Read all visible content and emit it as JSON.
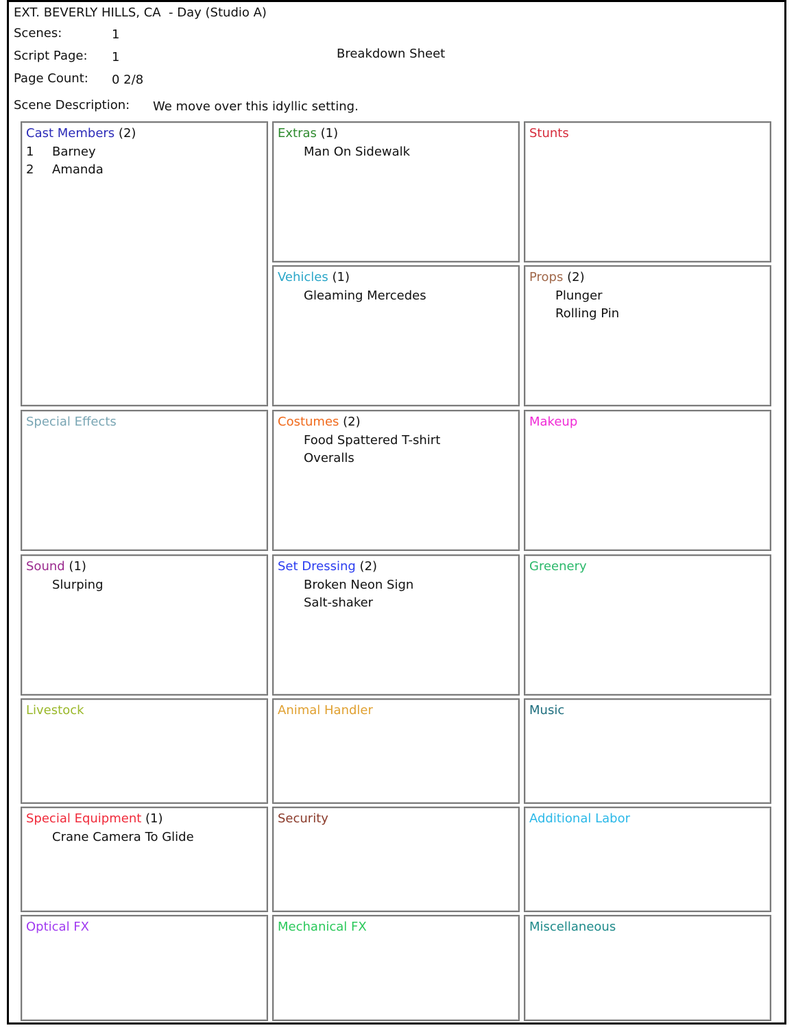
{
  "header": {
    "location": "EXT. BEVERLY HILLS, CA  - Day (Studio A)",
    "scenes_label": "Scenes:",
    "scenes_value": "1",
    "script_page_label": "Script Page:",
    "script_page_value": "1",
    "page_count_label": "Page Count:",
    "page_count_value": "0  2/8",
    "scene_description_label": "Scene Description:",
    "scene_description_value": "We move over this idyllic setting.",
    "sheet_title": "Breakdown Sheet"
  },
  "categories": {
    "cast": {
      "name": "Cast Members",
      "count": "(2)",
      "color": "#2b2bb8",
      "items": [
        {
          "num": "1",
          "label": "Barney"
        },
        {
          "num": "2",
          "label": "Amanda"
        }
      ]
    },
    "extras": {
      "name": "Extras",
      "count": "(1)",
      "color": "#2e8b2e",
      "items": [
        "Man On Sidewalk"
      ]
    },
    "stunts": {
      "name": "Stunts",
      "count": "",
      "color": "#d62b3b",
      "items": []
    },
    "vehicles": {
      "name": "Vehicles",
      "count": "(1)",
      "color": "#2aa6c8",
      "items": [
        "Gleaming Mercedes"
      ]
    },
    "props": {
      "name": "Props",
      "count": "(2)",
      "color": "#a0684a",
      "items": [
        "Plunger",
        "Rolling Pin"
      ]
    },
    "special_effects": {
      "name": "Special Effects",
      "count": "",
      "color": "#7aa6b4",
      "items": []
    },
    "costumes": {
      "name": "Costumes",
      "count": "(2)",
      "color": "#f06a1c",
      "items": [
        "Food Spattered T-shirt",
        "Overalls"
      ]
    },
    "makeup": {
      "name": "Makeup",
      "count": "",
      "color": "#f02ad6",
      "items": []
    },
    "sound": {
      "name": "Sound",
      "count": "(1)",
      "color": "#9a2a8e",
      "items": [
        "Slurping"
      ]
    },
    "set_dressing": {
      "name": "Set Dressing",
      "count": "(2)",
      "color": "#2a3cf0",
      "items": [
        "Broken Neon Sign",
        "Salt-shaker"
      ]
    },
    "greenery": {
      "name": "Greenery",
      "count": "",
      "color": "#2ab86a",
      "items": []
    },
    "livestock": {
      "name": "Livestock",
      "count": "",
      "color": "#9ab82a",
      "items": []
    },
    "animal_handler": {
      "name": "Animal Handler",
      "count": "",
      "color": "#e0a030",
      "items": []
    },
    "music": {
      "name": "Music",
      "count": "",
      "color": "#1e6e7e",
      "items": []
    },
    "special_equipment": {
      "name": "Special Equipment",
      "count": "(1)",
      "color": "#f02a3a",
      "items": [
        "Crane Camera To Glide"
      ]
    },
    "security": {
      "name": "Security",
      "count": "",
      "color": "#8a3a2a",
      "items": []
    },
    "additional_labor": {
      "name": "Additional Labor",
      "count": "",
      "color": "#2ab8e8",
      "items": []
    },
    "optical_fx": {
      "name": "Optical FX",
      "count": "",
      "color": "#a03af0",
      "items": []
    },
    "mechanical_fx": {
      "name": "Mechanical FX",
      "count": "",
      "color": "#2ac85a",
      "items": []
    },
    "miscellaneous": {
      "name": "Miscellaneous",
      "count": "",
      "color": "#1e8a8a",
      "items": []
    }
  }
}
